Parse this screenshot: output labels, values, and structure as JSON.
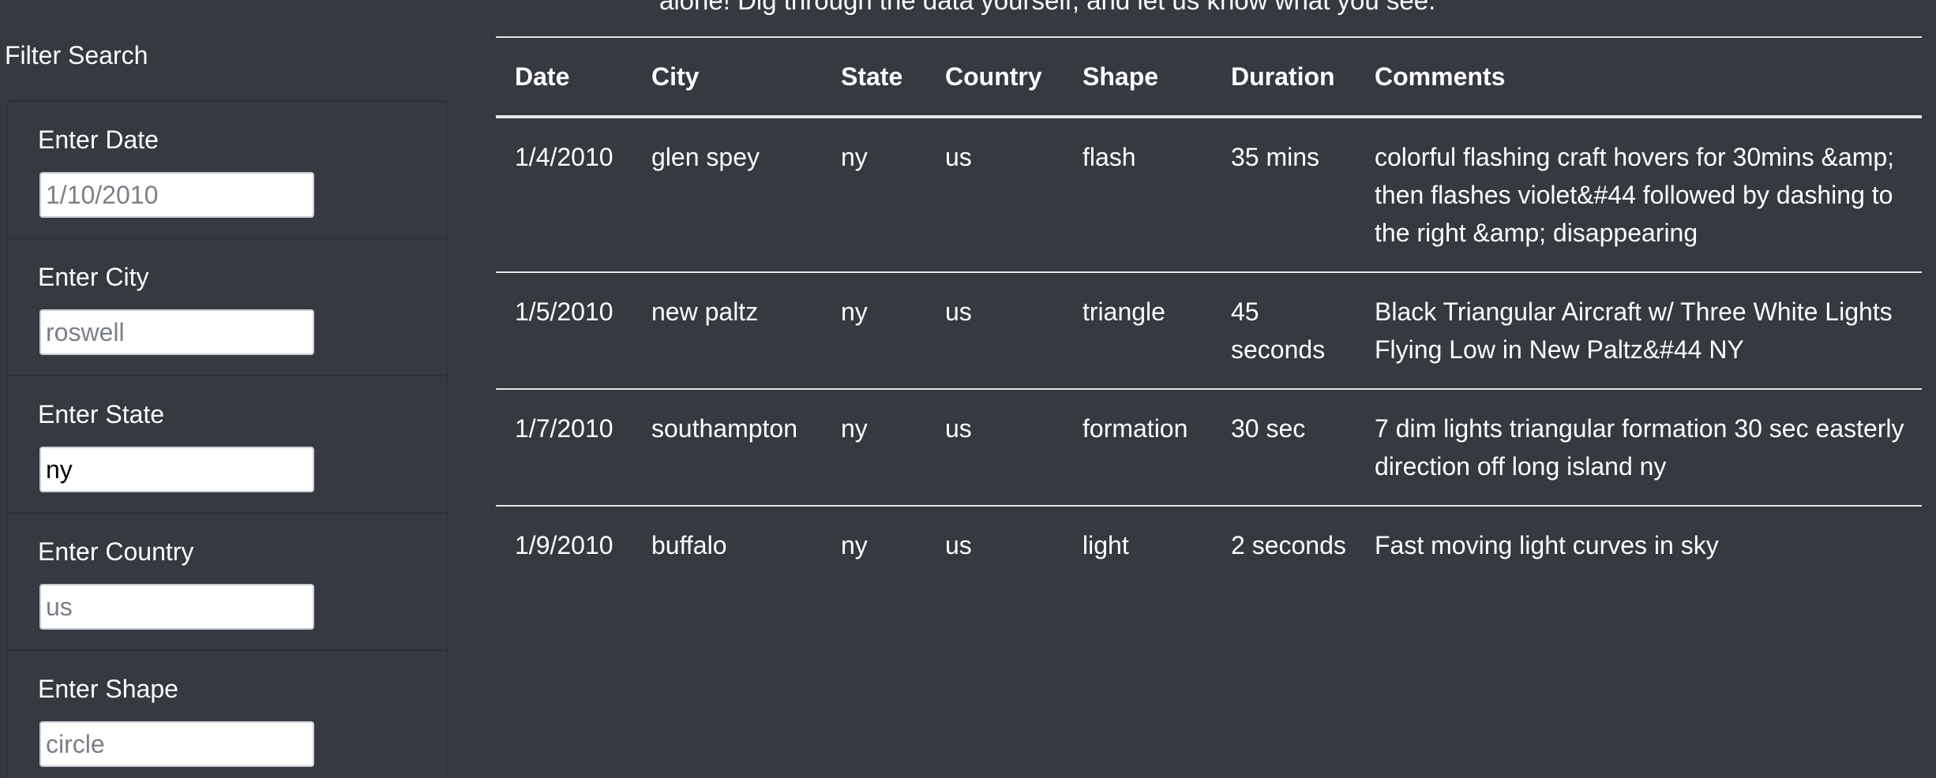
{
  "intro": {
    "text": "alone! Dig through the data yourself, and let us know what you see."
  },
  "sidebar": {
    "title": "Filter Search",
    "filters": [
      {
        "label": "Enter Date",
        "value": "",
        "placeholder": "1/10/2010"
      },
      {
        "label": "Enter City",
        "value": "",
        "placeholder": "roswell"
      },
      {
        "label": "Enter State",
        "value": "ny",
        "placeholder": ""
      },
      {
        "label": "Enter Country",
        "value": "",
        "placeholder": "us"
      },
      {
        "label": "Enter Shape",
        "value": "",
        "placeholder": "circle"
      }
    ]
  },
  "table": {
    "headers": [
      "Date",
      "City",
      "State",
      "Country",
      "Shape",
      "Duration",
      "Comments"
    ],
    "rows": [
      [
        "1/4/2010",
        "glen spey",
        "ny",
        "us",
        "flash",
        "35 mins",
        "colorful flashing craft hovers for 30mins &amp; then flashes violet&#44 followed by dashing to the right &amp; disappearing"
      ],
      [
        "1/5/2010",
        "new paltz",
        "ny",
        "us",
        "triangle",
        "45 seconds",
        "Black Triangular Aircraft w/ Three White Lights Flying Low in New Paltz&#44 NY"
      ],
      [
        "1/7/2010",
        "southampton",
        "ny",
        "us",
        "formation",
        "30 sec",
        "7 dim lights triangular formation 30 sec easterly direction off long island ny"
      ],
      [
        "1/9/2010",
        "buffalo",
        "ny",
        "us",
        "light",
        "2 seconds",
        "Fast moving light curves in sky"
      ]
    ]
  },
  "colors": {
    "background": "#353940",
    "text": "#ffffff",
    "rule": "#e6e6e6"
  }
}
